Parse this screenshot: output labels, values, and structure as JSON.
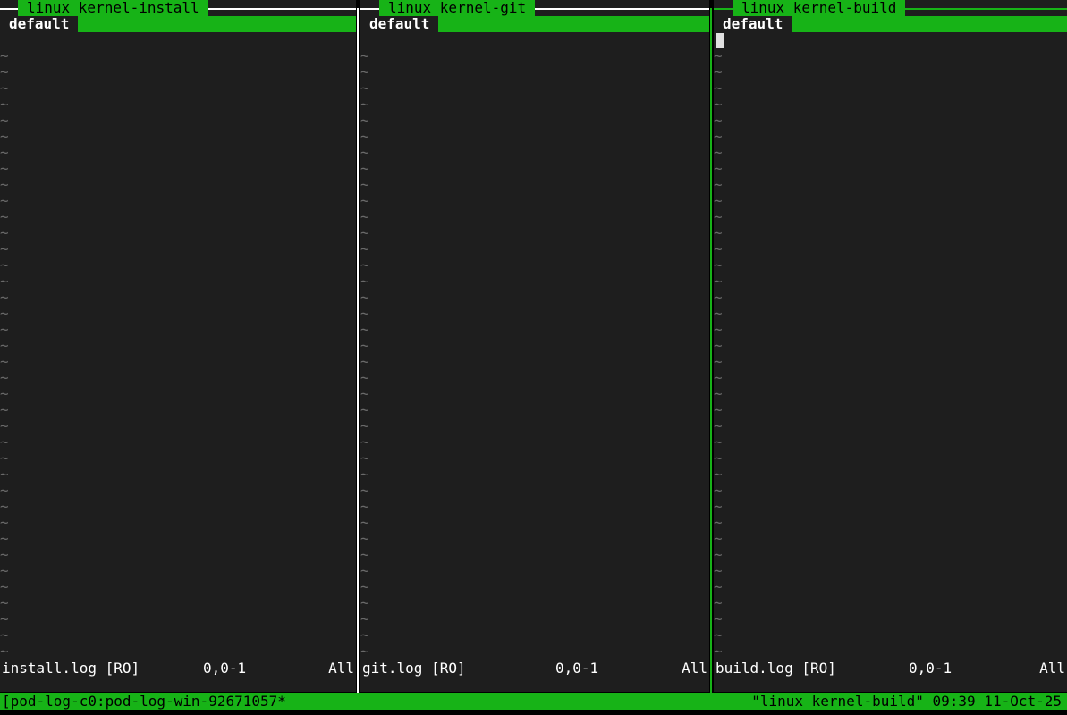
{
  "colors": {
    "accent": "#17b317",
    "pane_bg": "#1e1e1e",
    "border_inactive": "#ffffff",
    "border_active": "#17b317",
    "tilde": "#6a6a6a",
    "text": "#ffffff"
  },
  "panes": [
    {
      "title": "linux kernel-install",
      "tab": "default",
      "filename": "install.log [RO]",
      "position": "0,0-1",
      "scroll": "All",
      "active": false
    },
    {
      "title": "linux kernel-git",
      "tab": "default",
      "filename": "git.log [RO]",
      "position": "0,0-1",
      "scroll": "All",
      "active": false
    },
    {
      "title": "linux kernel-build",
      "tab": "default",
      "filename": "build.log [RO]",
      "position": "0,0-1",
      "scroll": "All",
      "active": true
    }
  ],
  "empty_line_marker": "~",
  "tmux_status": {
    "session": "[pod-log-c0:pod-log-win-92671057*",
    "right": "\"linux kernel-build\" 09:39 11-Oct-25"
  }
}
